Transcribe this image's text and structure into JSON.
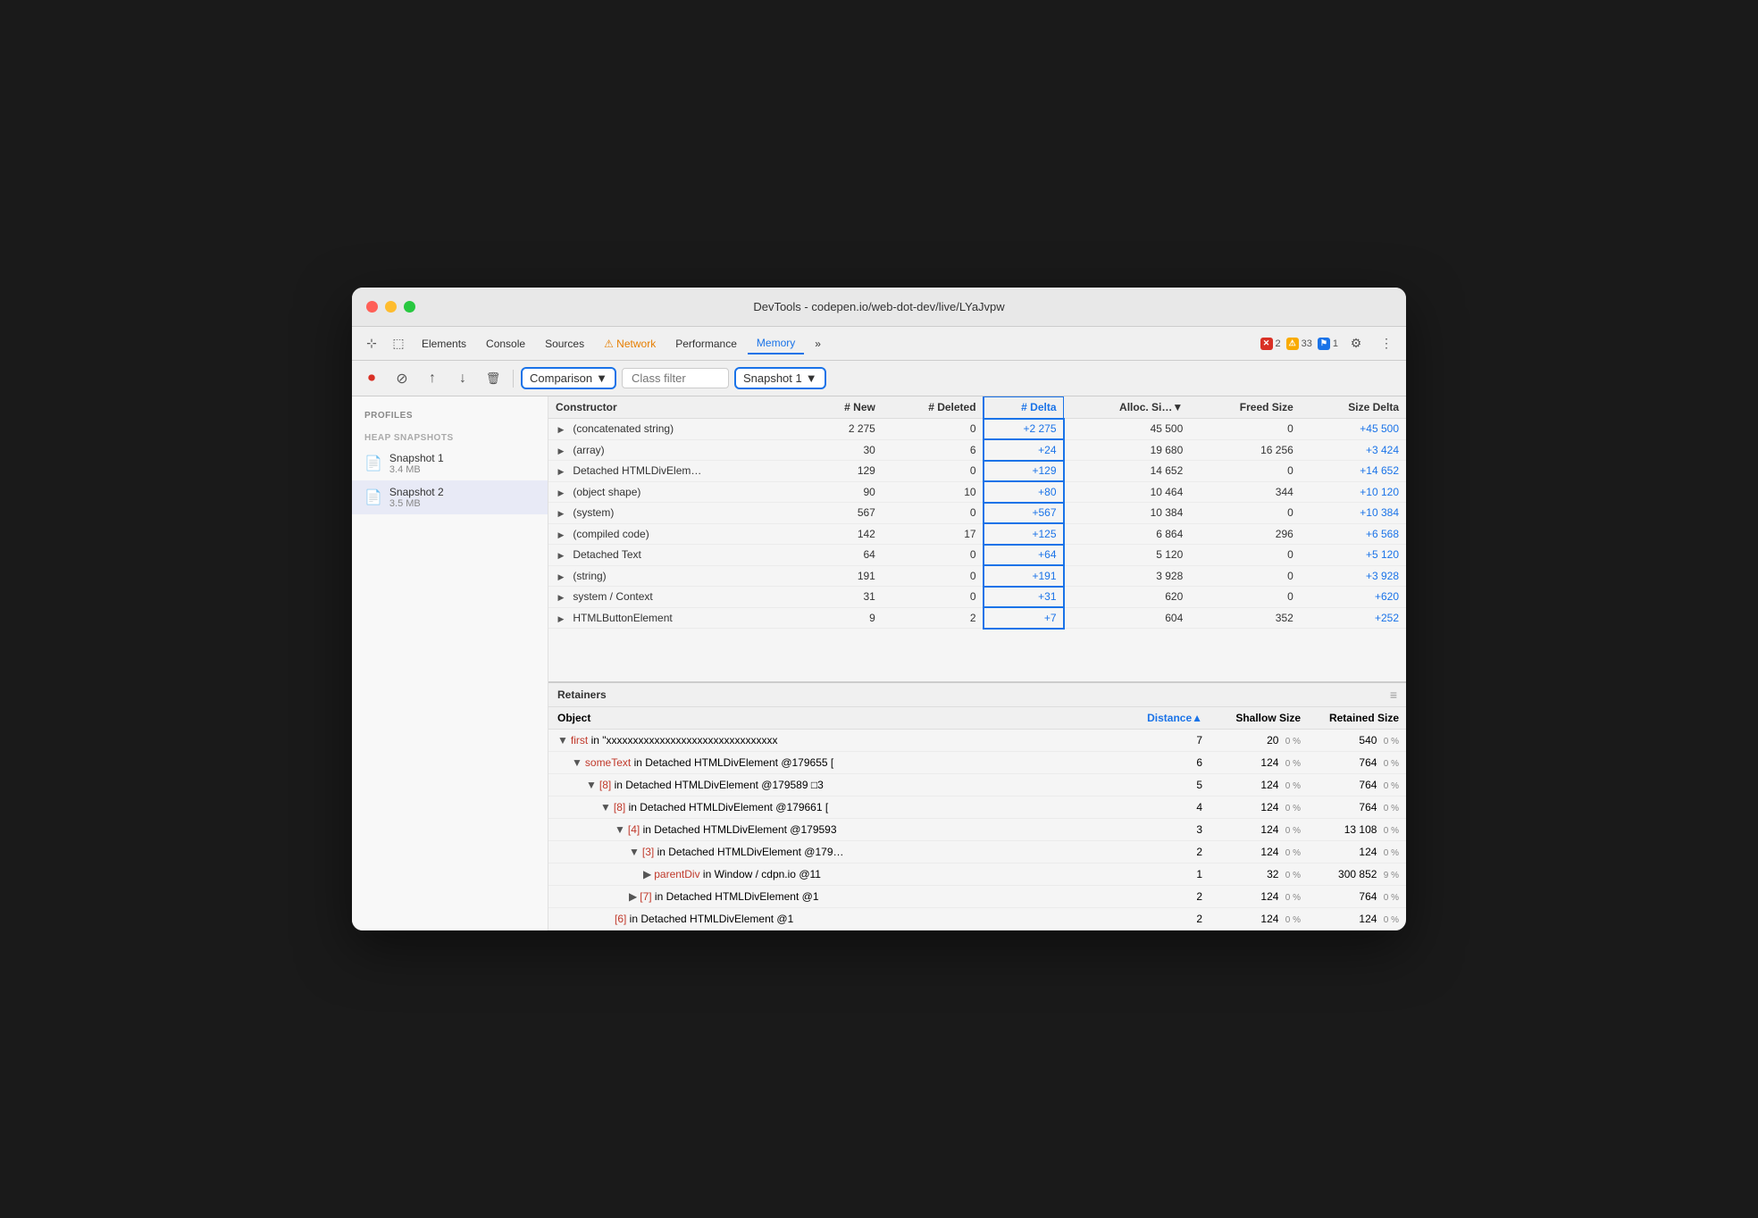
{
  "window": {
    "title": "DevTools - codepen.io/web-dot-dev/live/LYaJvpw"
  },
  "tabs": [
    {
      "label": "Elements",
      "active": false
    },
    {
      "label": "Console",
      "active": false
    },
    {
      "label": "Sources",
      "active": false
    },
    {
      "label": "⚠ Network",
      "active": false,
      "warning": true
    },
    {
      "label": "Performance",
      "active": false
    },
    {
      "label": "Memory",
      "active": true
    },
    {
      "label": "»",
      "active": false
    }
  ],
  "badges": [
    {
      "icon": "✕",
      "count": "2",
      "color": "red"
    },
    {
      "icon": "⚠",
      "count": "33",
      "color": "yellow"
    },
    {
      "icon": "⚑",
      "count": "1",
      "color": "blue"
    }
  ],
  "toolbar": {
    "comparison_label": "Comparison",
    "class_filter_placeholder": "Class filter",
    "snapshot_label": "Snapshot 1"
  },
  "sidebar": {
    "profiles_title": "Profiles",
    "heap_snapshots_title": "HEAP SNAPSHOTS",
    "snapshots": [
      {
        "name": "Snapshot 1",
        "size": "3.4 MB"
      },
      {
        "name": "Snapshot 2",
        "size": "3.5 MB",
        "active": true
      }
    ]
  },
  "table": {
    "headers": [
      {
        "label": "Constructor",
        "key": "constructor"
      },
      {
        "label": "# New",
        "key": "new"
      },
      {
        "label": "# Deleted",
        "key": "deleted"
      },
      {
        "label": "# Delta",
        "key": "delta",
        "sorted": true
      },
      {
        "label": "Alloc. Si…▼",
        "key": "alloc"
      },
      {
        "label": "Freed Size",
        "key": "freed"
      },
      {
        "label": "Size Delta",
        "key": "sizeDelta"
      }
    ],
    "rows": [
      {
        "constructor": "(concatenated string)",
        "new": "2 275",
        "deleted": "0",
        "delta": "+2 275",
        "alloc": "45 500",
        "freed": "0",
        "sizeDelta": "+45 500"
      },
      {
        "constructor": "(array)",
        "new": "30",
        "deleted": "6",
        "delta": "+24",
        "alloc": "19 680",
        "freed": "16 256",
        "sizeDelta": "+3 424"
      },
      {
        "constructor": "Detached HTMLDivElem…",
        "new": "129",
        "deleted": "0",
        "delta": "+129",
        "alloc": "14 652",
        "freed": "0",
        "sizeDelta": "+14 652"
      },
      {
        "constructor": "(object shape)",
        "new": "90",
        "deleted": "10",
        "delta": "+80",
        "alloc": "10 464",
        "freed": "344",
        "sizeDelta": "+10 120"
      },
      {
        "constructor": "(system)",
        "new": "567",
        "deleted": "0",
        "delta": "+567",
        "alloc": "10 384",
        "freed": "0",
        "sizeDelta": "+10 384"
      },
      {
        "constructor": "(compiled code)",
        "new": "142",
        "deleted": "17",
        "delta": "+125",
        "alloc": "6 864",
        "freed": "296",
        "sizeDelta": "+6 568"
      },
      {
        "constructor": "Detached Text",
        "new": "64",
        "deleted": "0",
        "delta": "+64",
        "alloc": "5 120",
        "freed": "0",
        "sizeDelta": "+5 120"
      },
      {
        "constructor": "(string)",
        "new": "191",
        "deleted": "0",
        "delta": "+191",
        "alloc": "3 928",
        "freed": "0",
        "sizeDelta": "+3 928"
      },
      {
        "constructor": "system / Context",
        "new": "31",
        "deleted": "0",
        "delta": "+31",
        "alloc": "620",
        "freed": "0",
        "sizeDelta": "+620"
      },
      {
        "constructor": "HTMLButtonElement",
        "new": "9",
        "deleted": "2",
        "delta": "+7",
        "alloc": "604",
        "freed": "352",
        "sizeDelta": "+252"
      }
    ]
  },
  "retainers": {
    "title": "Retainers",
    "headers": {
      "object": "Object",
      "distance": "Distance▲",
      "shallow": "Shallow Size",
      "retained": "Retained Size"
    },
    "rows": [
      {
        "indent": 0,
        "arrow": "▼",
        "text_before": "",
        "keyword": "first",
        "keyword_color": "red",
        "text_after": " in \"xxxxxxxxxxxxxxxxxxxxxxxxxxxxxxxx",
        "distance": "7",
        "shallow": "20",
        "shallow_pct": "0 %",
        "retained": "540",
        "retained_pct": "0 %"
      },
      {
        "indent": 1,
        "arrow": "▼",
        "text_before": "",
        "keyword": "someText",
        "keyword_color": "red",
        "text_after": " in Detached HTMLDivElement @179655 [",
        "distance": "6",
        "shallow": "124",
        "shallow_pct": "0 %",
        "retained": "764",
        "retained_pct": "0 %"
      },
      {
        "indent": 2,
        "arrow": "▼",
        "text_before": "",
        "keyword": "[8]",
        "keyword_color": "red",
        "text_after": " in Detached HTMLDivElement @179589 □3",
        "distance": "5",
        "shallow": "124",
        "shallow_pct": "0 %",
        "retained": "764",
        "retained_pct": "0 %"
      },
      {
        "indent": 3,
        "arrow": "▼",
        "text_before": "",
        "keyword": "[8]",
        "keyword_color": "red",
        "text_after": " in Detached HTMLDivElement @179661 [",
        "distance": "4",
        "shallow": "124",
        "shallow_pct": "0 %",
        "retained": "764",
        "retained_pct": "0 %"
      },
      {
        "indent": 4,
        "arrow": "▼",
        "text_before": "",
        "keyword": "[4]",
        "keyword_color": "red",
        "text_after": " in Detached HTMLDivElement @179593",
        "distance": "3",
        "shallow": "124",
        "shallow_pct": "0 %",
        "retained": "13 108",
        "retained_pct": "0 %"
      },
      {
        "indent": 5,
        "arrow": "▼",
        "text_before": "",
        "keyword": "[3]",
        "keyword_color": "red",
        "text_after": " in Detached HTMLDivElement @179…",
        "distance": "2",
        "shallow": "124",
        "shallow_pct": "0 %",
        "retained": "124",
        "retained_pct": "0 %"
      },
      {
        "indent": 6,
        "arrow": "▶",
        "text_before": "",
        "keyword": "parentDiv",
        "keyword_color": "red",
        "text_after": " in Window / cdpn.io @11",
        "distance": "1",
        "shallow": "32",
        "shallow_pct": "0 %",
        "retained": "300 852",
        "retained_pct": "9 %"
      },
      {
        "indent": 5,
        "arrow": "▶",
        "text_before": "",
        "keyword": "[7]",
        "keyword_color": "red",
        "text_after": " in Detached HTMLDivElement @1",
        "distance": "2",
        "shallow": "124",
        "shallow_pct": "0 %",
        "retained": "764",
        "retained_pct": "0 %"
      },
      {
        "indent": 4,
        "arrow": "",
        "text_before": "",
        "keyword": "[6]",
        "keyword_color": "red",
        "text_after": " in Detached HTMLDivElement @1",
        "distance": "2",
        "shallow": "124",
        "shallow_pct": "0 %",
        "retained": "124",
        "retained_pct": "0 %"
      }
    ]
  }
}
